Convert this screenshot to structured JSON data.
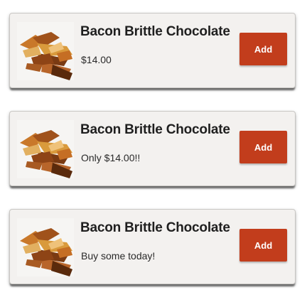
{
  "theme": {
    "accent": "#c23d1c",
    "card_background": "#f3f1ef"
  },
  "products": [
    {
      "title": "Bacon Brittle Chocolate",
      "subtitle": "$14.00",
      "button_label": "Add",
      "image_icon": "bacon-brittle-chocolate-image"
    },
    {
      "title": "Bacon Brittle Chocolate",
      "subtitle": "Only $14.00!!",
      "button_label": "Add",
      "image_icon": "bacon-brittle-chocolate-image"
    },
    {
      "title": "Bacon Brittle Chocolate",
      "subtitle": "Buy some today!",
      "button_label": "Add",
      "image_icon": "bacon-brittle-chocolate-image"
    }
  ]
}
